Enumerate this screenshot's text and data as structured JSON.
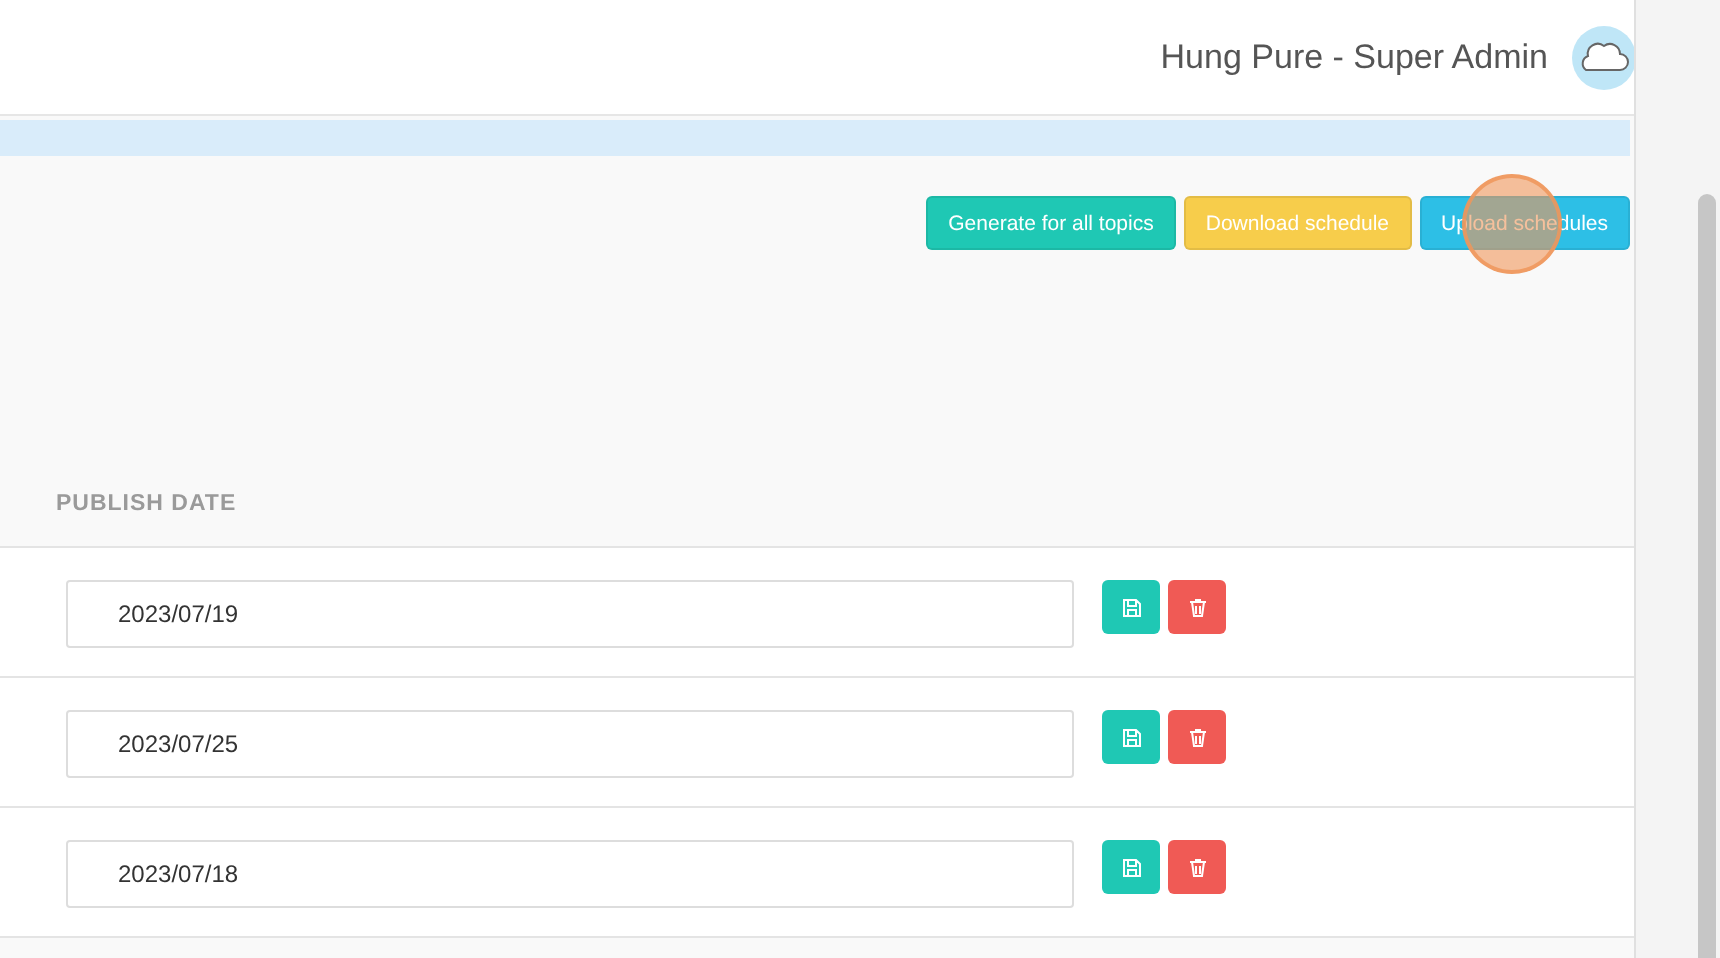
{
  "header": {
    "user": "Hung Pure - Super Admin"
  },
  "actions": [
    {
      "label": "Generate for all topics",
      "kind": "generate"
    },
    {
      "label": "Download schedule",
      "kind": "download"
    },
    {
      "label": "Upload schedules",
      "kind": "upload"
    }
  ],
  "table": {
    "columns": [
      "PUBLISH DATE"
    ],
    "rows": [
      {
        "publish_date": "2023/07/19"
      },
      {
        "publish_date": "2023/07/25"
      },
      {
        "publish_date": "2023/07/18"
      }
    ]
  }
}
